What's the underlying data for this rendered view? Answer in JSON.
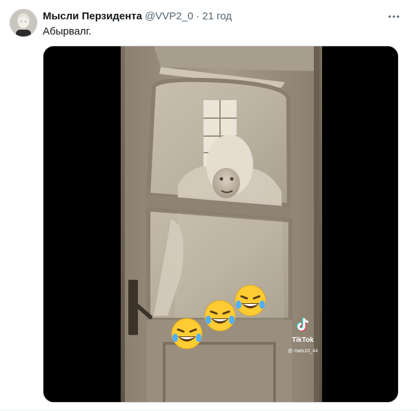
{
  "tweet": {
    "author_name": "Мысли Перзидента",
    "handle": "@VVP2_0",
    "separator": "·",
    "time": "21 год",
    "text": "Абырвалг.",
    "avatar_icon": "avatar-portrait",
    "more_icon": "more-horizontal-icon"
  },
  "media": {
    "type": "video",
    "watermark": {
      "brand": "TikTok",
      "user": "@ mats10_44",
      "icon": "tiktok-logo-icon"
    },
    "emojis": [
      "rolling-on-floor-laughing",
      "rolling-on-floor-laughing",
      "rolling-on-floor-laughing"
    ]
  },
  "colors": {
    "text_primary": "#0f1419",
    "text_secondary": "#536471",
    "media_border": "#cfd9de",
    "emoji_yellow": "#ffcc33"
  }
}
